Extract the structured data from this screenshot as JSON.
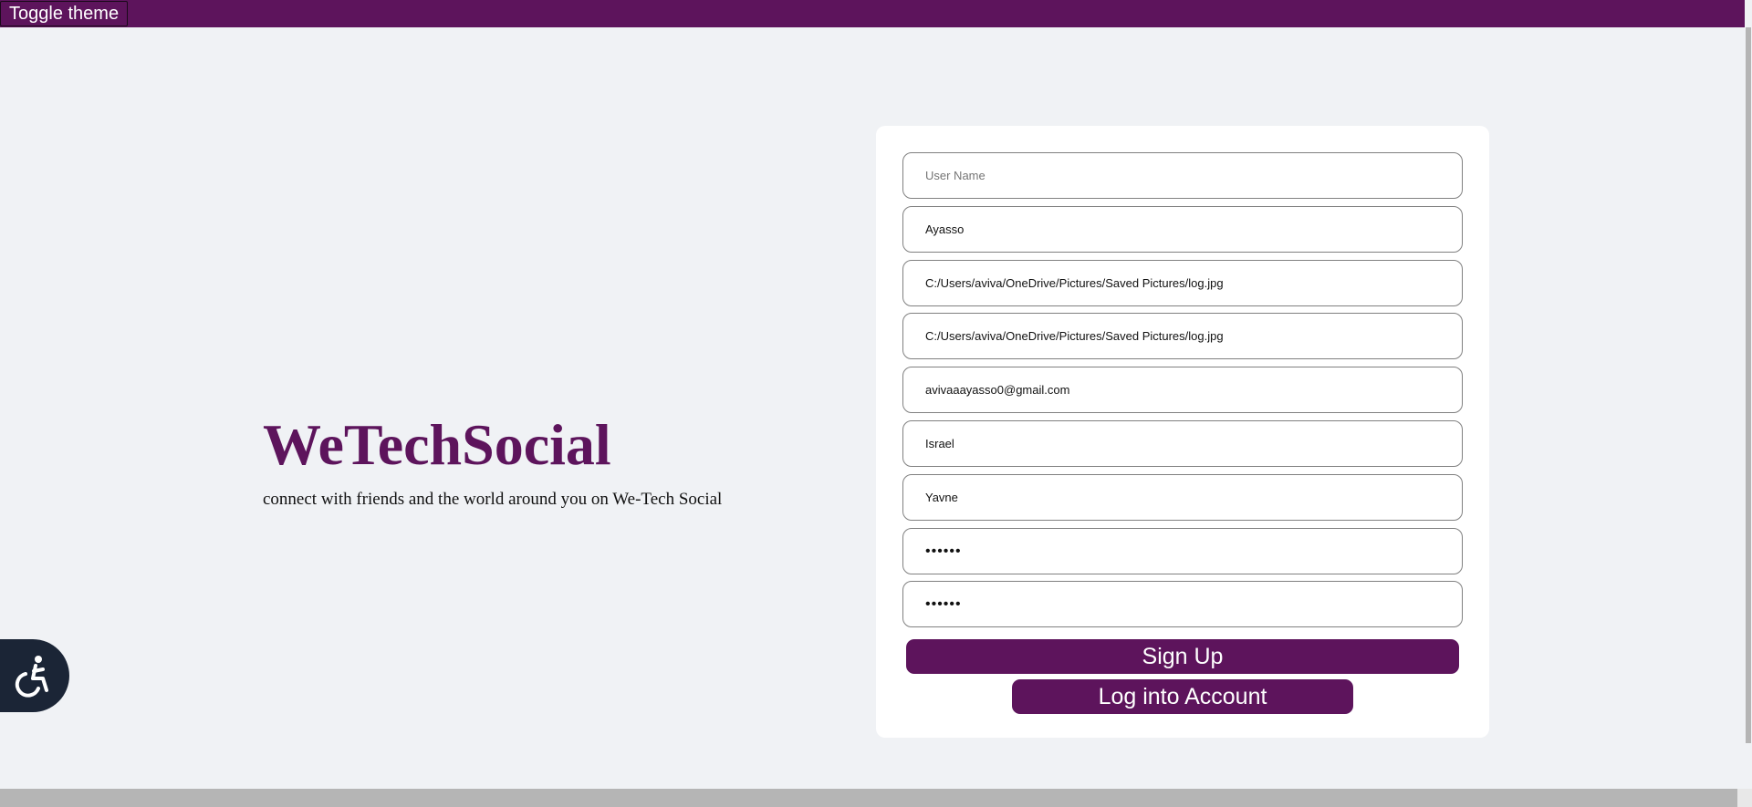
{
  "header": {
    "toggle_theme_label": "Toggle theme"
  },
  "brand": {
    "title": "WeTechSocial",
    "tagline": "connect with friends and the world around you on We-Tech Social"
  },
  "form": {
    "username": {
      "value": "",
      "placeholder": "User Name"
    },
    "name": {
      "value": "Ayasso"
    },
    "profile_picture": {
      "value": "C:/Users/aviva/OneDrive/Pictures/Saved Pictures/log.jpg"
    },
    "cover_picture": {
      "value": "C:/Users/aviva/OneDrive/Pictures/Saved Pictures/log.jpg"
    },
    "email": {
      "value": "avivaaayasso0@gmail.com"
    },
    "country": {
      "value": "Israel"
    },
    "city": {
      "value": "Yavne"
    },
    "password": {
      "value": "••••••"
    },
    "confirm_password": {
      "value": "••••••"
    },
    "signup_label": "Sign Up",
    "login_label": "Log into Account"
  },
  "accessibility": {
    "icon": "accessibility-icon"
  },
  "colors": {
    "brand": "#5d145c",
    "background": "#f0f2f5",
    "card": "#ffffff",
    "a11y_button": "#1b2536"
  }
}
